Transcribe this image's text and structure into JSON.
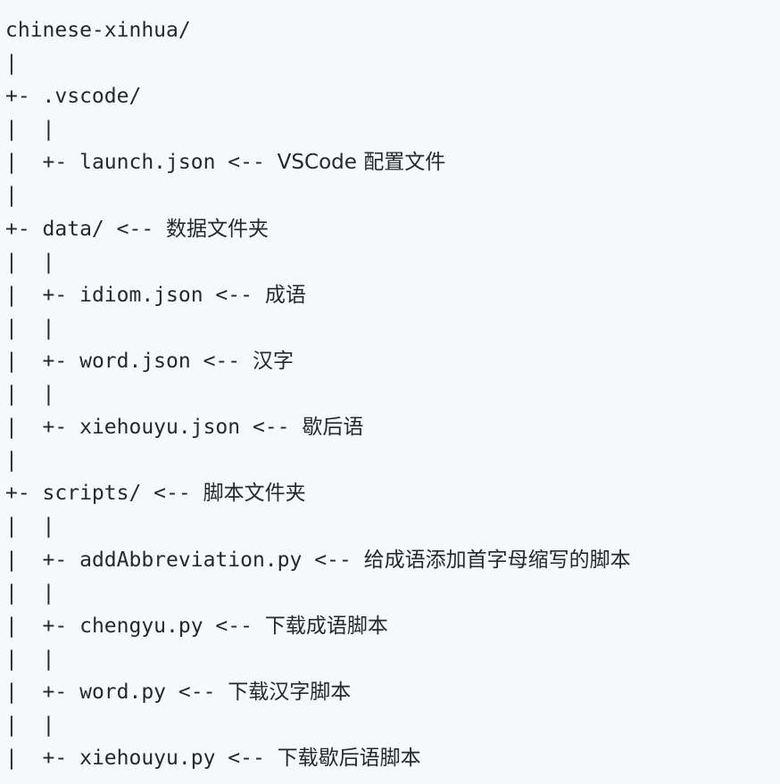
{
  "lines": [
    {
      "prefix": "",
      "name": "chinese-xinhua/",
      "comment": ""
    },
    {
      "prefix": "|",
      "name": "",
      "comment": ""
    },
    {
      "prefix": "+- ",
      "name": ".vscode/",
      "comment": ""
    },
    {
      "prefix": "|  |",
      "name": "",
      "comment": ""
    },
    {
      "prefix": "|  +- ",
      "name": "launch.json",
      "comment": "VSCode 配置文件"
    },
    {
      "prefix": "|",
      "name": "",
      "comment": ""
    },
    {
      "prefix": "+- ",
      "name": "data/",
      "comment": "数据文件夹"
    },
    {
      "prefix": "|  |",
      "name": "",
      "comment": ""
    },
    {
      "prefix": "|  +- ",
      "name": "idiom.json",
      "comment": "成语"
    },
    {
      "prefix": "|  |",
      "name": "",
      "comment": ""
    },
    {
      "prefix": "|  +- ",
      "name": "word.json",
      "comment": "汉字"
    },
    {
      "prefix": "|  |",
      "name": "",
      "comment": ""
    },
    {
      "prefix": "|  +- ",
      "name": "xiehouyu.json",
      "comment": "歇后语"
    },
    {
      "prefix": "|",
      "name": "",
      "comment": ""
    },
    {
      "prefix": "+- ",
      "name": "scripts/",
      "comment": "脚本文件夹"
    },
    {
      "prefix": "|  |",
      "name": "",
      "comment": ""
    },
    {
      "prefix": "|  +- ",
      "name": "addAbbreviation.py",
      "comment": "给成语添加首字母缩写的脚本"
    },
    {
      "prefix": "|  |",
      "name": "",
      "comment": ""
    },
    {
      "prefix": "|  +- ",
      "name": "chengyu.py",
      "comment": "下载成语脚本"
    },
    {
      "prefix": "|  |",
      "name": "",
      "comment": ""
    },
    {
      "prefix": "|  +- ",
      "name": "word.py",
      "comment": "下载汉字脚本"
    },
    {
      "prefix": "|  |",
      "name": "",
      "comment": ""
    },
    {
      "prefix": "|  +- ",
      "name": "xiehouyu.py",
      "comment": "下载歇后语脚本"
    }
  ],
  "arrow": " <-- "
}
